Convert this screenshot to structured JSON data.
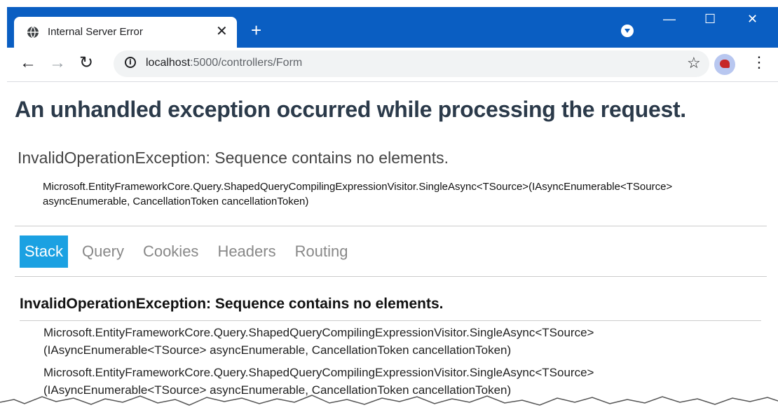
{
  "browser": {
    "tab_title": "Internal Server Error",
    "tab_close": "✕",
    "new_tab": "+",
    "window_buttons": {
      "minimize": "—",
      "maximize": "☐",
      "close": "✕"
    },
    "nav": {
      "back": "←",
      "forward": "→",
      "reload": "↻"
    },
    "url_host": "localhost",
    "url_rest": ":5000/controllers/Form",
    "star": "☆",
    "menu": "⋮"
  },
  "error_page": {
    "heading": "An unhandled exception occurred while processing the request.",
    "exception_message": "InvalidOperationException: Sequence contains no elements.",
    "location": "Microsoft.EntityFrameworkCore.Query.ShapedQueryCompilingExpressionVisitor.SingleAsync<TSource>(IAsyncEnumerable<TSource> asyncEnumerable, CancellationToken cancellationToken)",
    "tabs": [
      "Stack",
      "Query",
      "Cookies",
      "Headers",
      "Routing"
    ],
    "stack_heading": "InvalidOperationException: Sequence contains no elements.",
    "frames": [
      {
        "line1": "Microsoft.EntityFrameworkCore.Query.ShapedQueryCompilingExpressionVisitor.SingleAsync<TSource>",
        "line2": "(IAsyncEnumerable<TSource> asyncEnumerable, CancellationToken cancellationToken)"
      },
      {
        "line1": "Microsoft.EntityFrameworkCore.Query.ShapedQueryCompilingExpressionVisitor.SingleAsync<TSource>",
        "line2": "(IAsyncEnumerable<TSource> asyncEnumerable, CancellationToken cancellationToken)"
      }
    ]
  },
  "colors": {
    "titlebar": "#0a5ec2",
    "active_tab": "#1ba1e2",
    "heading": "#2b3a4a"
  }
}
